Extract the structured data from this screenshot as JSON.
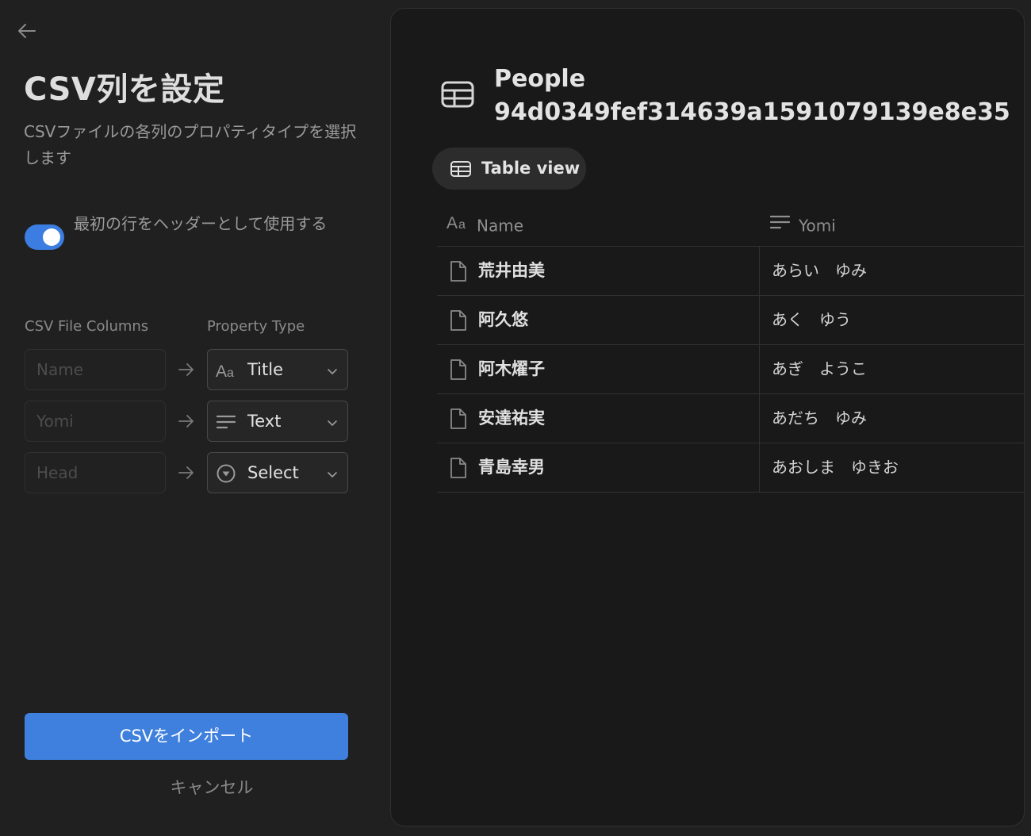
{
  "left": {
    "title": "CSV列を設定",
    "subtitle": "CSVファイルの各列のプロパティタイプを選択します",
    "toggle": {
      "on": true,
      "label": "最初の行をヘッダーとして使用する"
    },
    "columns_header": {
      "csv": "CSV File Columns",
      "property": "Property Type"
    },
    "mappings": [
      {
        "csv_column": "Name",
        "property_type": "Title",
        "icon": "aa-icon"
      },
      {
        "csv_column": "Yomi",
        "property_type": "Text",
        "icon": "text-lines-icon"
      },
      {
        "csv_column": "Head",
        "property_type": "Select",
        "icon": "select-circle-icon"
      }
    ],
    "import_label": "CSVをインポート",
    "cancel_label": "キャンセル"
  },
  "right": {
    "database_name": "People 94d0349fef314639a1591079139e8e35",
    "view_tab": "Table view",
    "columns": [
      {
        "label": "Name",
        "icon": "aa-icon"
      },
      {
        "label": "Yomi",
        "icon": "text-lines-icon"
      }
    ],
    "rows": [
      {
        "name": "荒井由美",
        "yomi": "あらい　ゆみ"
      },
      {
        "name": "阿久悠",
        "yomi": "あく　ゆう"
      },
      {
        "name": "阿木燿子",
        "yomi": "あぎ　ようこ"
      },
      {
        "name": "安達祐実",
        "yomi": "あだち　ゆみ"
      },
      {
        "name": "青島幸男",
        "yomi": "あおしま　ゆきお"
      }
    ]
  },
  "colors": {
    "background": "#202020",
    "panel": "#191919",
    "accent": "#3f80de",
    "toggle_on": "#3b7de0"
  }
}
